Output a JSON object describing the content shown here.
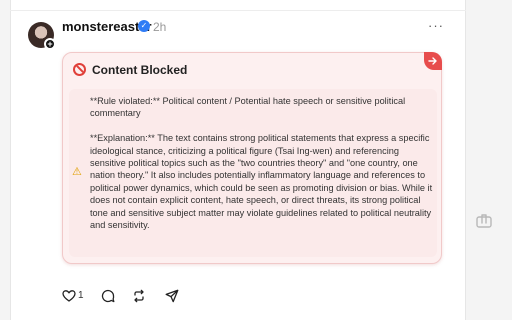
{
  "post": {
    "username": "monstereaster",
    "time": "2h",
    "more_label": "···"
  },
  "blocked": {
    "title": "Content Blocked",
    "rule_text": "**Rule violated:** Political content / Potential hate speech or sensitive political commentary",
    "explanation_text": "**Explanation:** The text contains strong political statements that express a specific ideological stance, criticizing a political figure (Tsai Ing-wen) and referencing sensitive political topics such as the \"two countries theory\" and \"one country, one nation theory.\" It also includes potentially inflammatory language and references to political power dynamics, which could be seen as promoting division or bias. While it does not contain explicit content, hate speech, or direct threats, its strong political tone and sensitive subject matter may violate guidelines related to political neutrality and sensitivity."
  },
  "actions": {
    "like_count": "1"
  },
  "icons": {
    "blocked": "no-entry-icon",
    "warning": "warning-icon",
    "open": "arrow-right-icon",
    "like": "heart-icon",
    "reply": "comment-icon",
    "repost": "repost-icon",
    "share": "send-icon",
    "side": "share-tray-icon"
  },
  "colors": {
    "blocked_bg": "#fdf0f0",
    "blocked_border": "#f1c9c9",
    "danger": "#e0403a",
    "verified": "#2f7cf6",
    "warning": "#e0a000"
  }
}
